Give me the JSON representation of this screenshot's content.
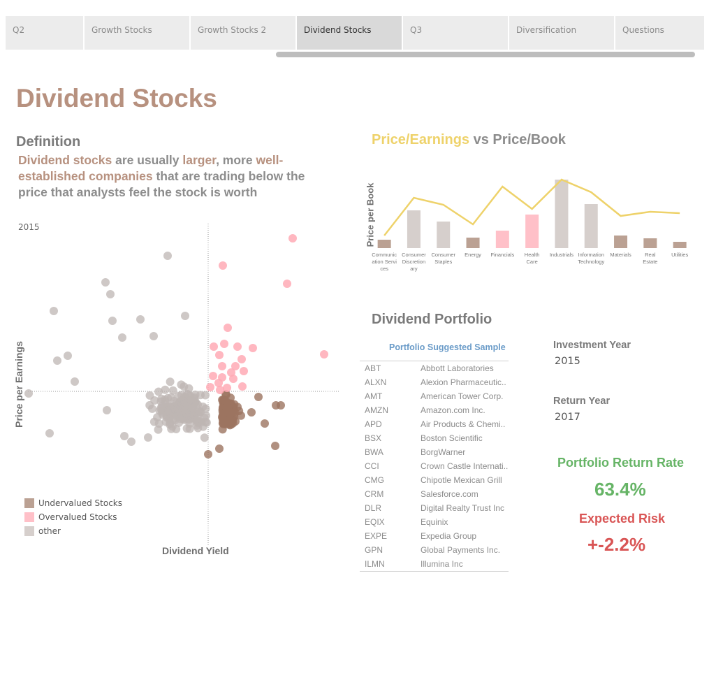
{
  "tabs": [
    {
      "label": "Q2",
      "active": false
    },
    {
      "label": "Growth Stocks",
      "active": false
    },
    {
      "label": "Growth Stocks 2",
      "active": false
    },
    {
      "label": "Dividend Stocks",
      "active": true
    },
    {
      "label": "Q3",
      "active": false
    },
    {
      "label": "Diversification",
      "active": false
    },
    {
      "label": "Questions",
      "active": false
    }
  ],
  "page_title": "Dividend Stocks",
  "definition": {
    "heading": "Definition",
    "parts": [
      {
        "text": "Dividend stocks",
        "highlight": true
      },
      {
        "text": " are usually ",
        "highlight": false
      },
      {
        "text": "larger",
        "highlight": true
      },
      {
        "text": ", more ",
        "highlight": false
      },
      {
        "text": "well-established companies",
        "highlight": true
      },
      {
        "text": " that are trading below the price that analysts feel the stock is worth",
        "highlight": false
      }
    ]
  },
  "colors": {
    "undervalued": "#9c7460",
    "overvalued": "#ffaab5",
    "other": "#bdb6b3",
    "brand": "#b7917f",
    "pe_line": "#eed26a",
    "bar_default": "#d6cfcc",
    "bar_brown": "#bba193",
    "bar_pink": "#ffc0c8",
    "green": "#66b466",
    "red": "#d95555",
    "blue": "#6a9bc8"
  },
  "scatter": {
    "year": "2015",
    "xlabel": "Dividend Yield",
    "ylabel": "Price per Earnings",
    "legend": [
      {
        "label": "Undervalued Stocks",
        "key": "undervalued"
      },
      {
        "label": "Overvalued Stocks",
        "key": "overvalued"
      },
      {
        "label": "other",
        "key": "other"
      }
    ]
  },
  "chart_data": {
    "type": "bar",
    "title_highlight": "Price/Earnings",
    "title_rest": " vs Price/Book",
    "ylabel": "Price per Book",
    "categories": [
      "Communication Services",
      "Consumer Discretionary",
      "Consumer Staples",
      "Energy",
      "Financials",
      "Health Care",
      "Industrials",
      "Information Technology",
      "Materials",
      "Real Estate",
      "Utilities"
    ],
    "category_labels": [
      [
        "Communic",
        "ation Servi",
        "ces"
      ],
      [
        "Consumer",
        "Discretion",
        "ary"
      ],
      [
        "Consumer",
        "Staples"
      ],
      [
        "Energy"
      ],
      [
        "Financials"
      ],
      [
        "Health",
        "Care"
      ],
      [
        "Industrials"
      ],
      [
        "Information",
        "Technology"
      ],
      [
        "Materials"
      ],
      [
        "Real",
        "Estate"
      ],
      [
        "Utilities"
      ]
    ],
    "series": [
      {
        "name": "Price per Book",
        "values": [
          1.2,
          5.4,
          3.8,
          1.5,
          2.5,
          4.8,
          9.8,
          6.3,
          1.8,
          1.4,
          0.9
        ],
        "color_keys": [
          "bar_brown",
          "bar_default",
          "bar_default",
          "bar_brown",
          "bar_pink",
          "bar_pink",
          "bar_default",
          "bar_default",
          "bar_brown",
          "bar_brown",
          "bar_brown"
        ]
      },
      {
        "name": "Price/Earnings",
        "values": [
          1.8,
          7.2,
          6.2,
          3.4,
          8.8,
          5.6,
          9.8,
          8.0,
          4.6,
          5.2,
          5.0
        ]
      }
    ],
    "ylim": [
      0,
      10
    ]
  },
  "portfolio": {
    "title": "Dividend Portfolio",
    "subtitle": "Portfolio Suggested Sample",
    "rows": [
      {
        "ticker": "ABT",
        "name": "Abbott Laboratories"
      },
      {
        "ticker": "ALXN",
        "name": "Alexion Pharmaceutic.."
      },
      {
        "ticker": "AMT",
        "name": "American Tower Corp."
      },
      {
        "ticker": "AMZN",
        "name": "Amazon.com Inc."
      },
      {
        "ticker": "APD",
        "name": "Air Products & Chemi.."
      },
      {
        "ticker": "BSX",
        "name": "Boston Scientific"
      },
      {
        "ticker": "BWA",
        "name": "BorgWarner"
      },
      {
        "ticker": "CCI",
        "name": "Crown Castle Internati.."
      },
      {
        "ticker": "CMG",
        "name": "Chipotle Mexican Grill"
      },
      {
        "ticker": "CRM",
        "name": "Salesforce.com"
      },
      {
        "ticker": "DLR",
        "name": "Digital Realty Trust Inc"
      },
      {
        "ticker": "EQIX",
        "name": "Equinix"
      },
      {
        "ticker": "EXPE",
        "name": "Expedia Group"
      },
      {
        "ticker": "GPN",
        "name": "Global Payments Inc."
      },
      {
        "ticker": "ILMN",
        "name": "Illumina Inc"
      }
    ]
  },
  "investment_year": {
    "label": "Investment Year",
    "value": "2015"
  },
  "return_year": {
    "label": "Return Year",
    "value": "2017"
  },
  "return_rate": {
    "label": "Portfolio Return Rate",
    "value": "63.4%"
  },
  "risk": {
    "label": "Expected Risk",
    "value": "+-2.2%"
  }
}
